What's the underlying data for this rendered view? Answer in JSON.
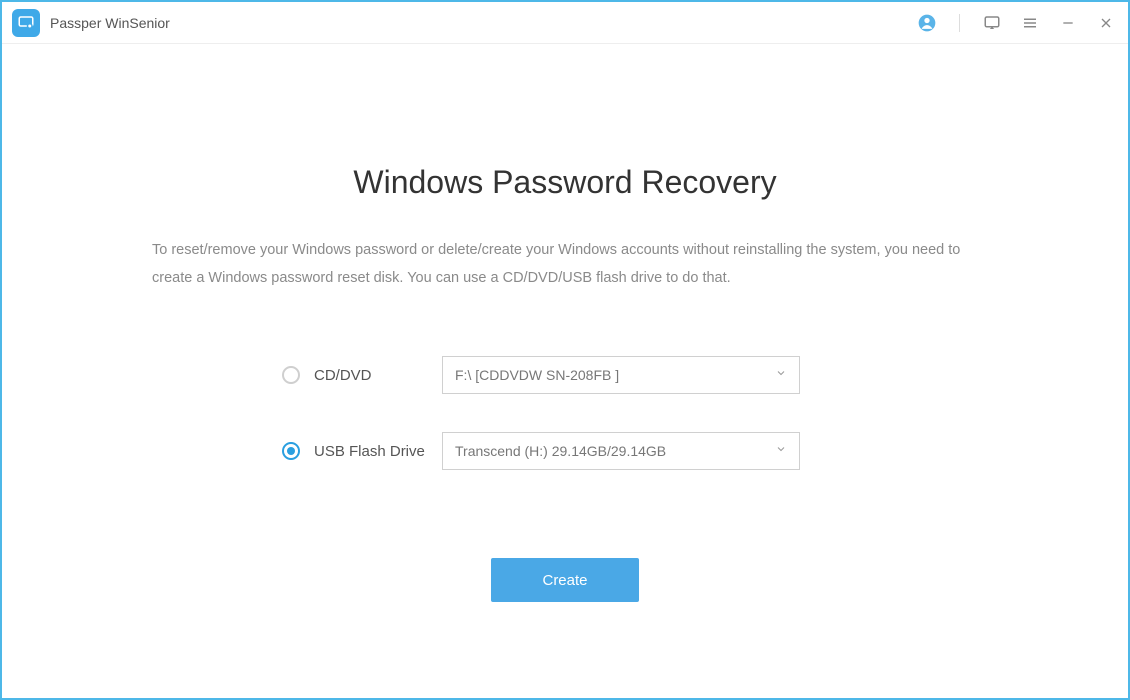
{
  "app": {
    "title": "Passper WinSenior"
  },
  "titlebar": {
    "icons": {
      "user": "user-icon",
      "feedback": "feedback-icon",
      "menu": "menu-icon",
      "minimize": "minimize-icon",
      "close": "close-icon"
    }
  },
  "main": {
    "title": "Windows Password Recovery",
    "description": "To reset/remove your Windows password or delete/create your Windows accounts without reinstalling the system, you need to create a Windows password reset disk. You can use a CD/DVD/USB flash drive to do that."
  },
  "options": {
    "cd": {
      "label": "CD/DVD",
      "selected": false,
      "value": "F:\\ [CDDVDW SN-208FB ]"
    },
    "usb": {
      "label": "USB Flash Drive",
      "selected": true,
      "value": "Transcend (H:) 29.14GB/29.14GB"
    }
  },
  "actions": {
    "create": "Create"
  }
}
